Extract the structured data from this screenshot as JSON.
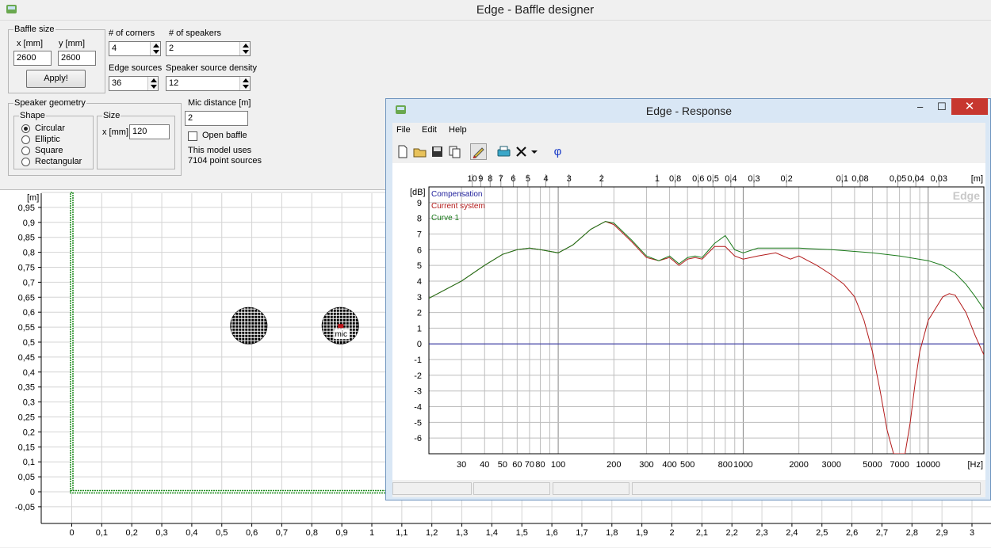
{
  "app": {
    "title": "Edge - Baffle designer"
  },
  "baffle_size": {
    "title": "Baffle size",
    "x_label": "x [mm]",
    "y_label": "y [mm]",
    "x_value": "2600",
    "y_value": "2600",
    "apply_label": "Apply!"
  },
  "corners": {
    "label": "# of corners",
    "value": "4"
  },
  "speakers": {
    "label": "# of speakers",
    "value": "2"
  },
  "edge_sources": {
    "label": "Edge sources",
    "value": "36"
  },
  "source_density": {
    "label": "Speaker source density",
    "value": "12"
  },
  "speaker_geometry": {
    "title": "Speaker geometry",
    "shape_title": "Shape",
    "shapes": [
      "Circular",
      "Elliptic",
      "Square",
      "Rectangular"
    ],
    "selected_shape": "Circular",
    "size_title": "Size",
    "size_x_label": "x [mm]",
    "size_x_value": "120"
  },
  "mic": {
    "label": "Mic distance [m]",
    "value": "2",
    "open_baffle_label": "Open baffle",
    "open_baffle_checked": false,
    "info_line1": "This model uses",
    "info_line2": "7104 point sources",
    "mic_label": "mic"
  },
  "baffle_plot": {
    "unit": "[m]",
    "y_ticks": [
      "0,95",
      "0,9",
      "0,85",
      "0,8",
      "0,75",
      "0,7",
      "0,65",
      "0,6",
      "0,55",
      "0,5",
      "0,45",
      "0,4",
      "0,35",
      "0,3",
      "0,25",
      "0,2",
      "0,15",
      "0,1",
      "0,05",
      "0",
      "-0,05"
    ],
    "x_ticks": [
      "0",
      "0,1",
      "0,2",
      "0,3",
      "0,4",
      "0,5",
      "0,6",
      "0,7",
      "0,8",
      "0,9",
      "1",
      "1,1",
      "1,2",
      "1,3",
      "1,4",
      "1,5",
      "1,6",
      "1,7",
      "1,8",
      "1,9",
      "2",
      "2,1",
      "2,2",
      "2,3",
      "2,4",
      "2,5",
      "2,6",
      "2,7",
      "2,8",
      "2,9",
      "3"
    ],
    "speakers_m": [
      {
        "x": 0.59,
        "y": 0.555
      },
      {
        "x": 0.895,
        "y": 0.555
      }
    ],
    "baffle_color": "#1a8a1a"
  },
  "response_window": {
    "title": "Edge - Response",
    "minimize": "–",
    "maximize": "☐",
    "close": "✕",
    "menu": [
      "File",
      "Edit",
      "Help"
    ],
    "toolbar_icons": [
      "new-file-icon",
      "open-folder-icon",
      "save-icon",
      "copy-icon",
      "pencil-icon",
      "printer-icon",
      "delete-icon",
      "dropdown-arrow-icon",
      "phase-icon"
    ],
    "phase_symbol": "φ",
    "watermark": "Edge"
  },
  "chart_data": {
    "type": "line",
    "ylabel": "[dB]",
    "xlabel": "[Hz]",
    "top_axis_unit": "[m]",
    "ylim": [
      -7,
      10
    ],
    "xlim_hz": [
      20,
      20000
    ],
    "x_scale": "log",
    "y_ticks": [
      9,
      8,
      7,
      6,
      5,
      4,
      3,
      2,
      1,
      0,
      -1,
      -2,
      -3,
      -4,
      -5,
      -6
    ],
    "x_tick_labels": [
      {
        "hz": 30,
        "label": "30"
      },
      {
        "hz": 40,
        "label": "40"
      },
      {
        "hz": 50,
        "label": "50"
      },
      {
        "hz": 60,
        "label": "60"
      },
      {
        "hz": 70,
        "label": "70"
      },
      {
        "hz": 80,
        "label": "80"
      },
      {
        "hz": 100,
        "label": "100"
      },
      {
        "hz": 200,
        "label": "200"
      },
      {
        "hz": 300,
        "label": "300"
      },
      {
        "hz": 400,
        "label": "400"
      },
      {
        "hz": 500,
        "label": "500"
      },
      {
        "hz": 800,
        "label": "800"
      },
      {
        "hz": 1000,
        "label": "1000"
      },
      {
        "hz": 2000,
        "label": "2000"
      },
      {
        "hz": 3000,
        "label": "3000"
      },
      {
        "hz": 5000,
        "label": "5000"
      },
      {
        "hz": 7000,
        "label": "7000"
      },
      {
        "hz": 10000,
        "label": "10000"
      }
    ],
    "top_tick_labels": [
      {
        "m": 10,
        "label": "10"
      },
      {
        "m": 9,
        "label": "9"
      },
      {
        "m": 8,
        "label": "8"
      },
      {
        "m": 7,
        "label": "7"
      },
      {
        "m": 6,
        "label": "6"
      },
      {
        "m": 5,
        "label": "5"
      },
      {
        "m": 4,
        "label": "4"
      },
      {
        "m": 3,
        "label": "3"
      },
      {
        "m": 2,
        "label": "2"
      },
      {
        "m": 1,
        "label": "1"
      },
      {
        "m": 0.8,
        "label": "0,8"
      },
      {
        "m": 0.6,
        "label": "0,6"
      },
      {
        "m": 0.5,
        "label": "0,5"
      },
      {
        "m": 0.4,
        "label": "0,4"
      },
      {
        "m": 0.3,
        "label": "0,3"
      },
      {
        "m": 0.2,
        "label": "0,2"
      },
      {
        "m": 0.1,
        "label": "0,1"
      },
      {
        "m": 0.08,
        "label": "0,08"
      },
      {
        "m": 0.05,
        "label": "0,05"
      },
      {
        "m": 0.04,
        "label": "0,04"
      },
      {
        "m": 0.03,
        "label": "0,03"
      }
    ],
    "grid": true,
    "legend_placement": "top-left",
    "series": [
      {
        "name": "Compensation",
        "color": "#1c1c9a",
        "points": [
          [
            20,
            0
          ],
          [
            20000,
            0
          ]
        ]
      },
      {
        "name": "Current system",
        "color": "#b31a1a",
        "points": [
          [
            20,
            2.9
          ],
          [
            30,
            4.0
          ],
          [
            40,
            5.0
          ],
          [
            50,
            5.7
          ],
          [
            60,
            6.0
          ],
          [
            70,
            6.1
          ],
          [
            80,
            6.0
          ],
          [
            100,
            5.8
          ],
          [
            120,
            6.3
          ],
          [
            150,
            7.3
          ],
          [
            180,
            7.8
          ],
          [
            200,
            7.6
          ],
          [
            250,
            6.5
          ],
          [
            300,
            5.5
          ],
          [
            350,
            5.3
          ],
          [
            400,
            5.5
          ],
          [
            450,
            5.0
          ],
          [
            500,
            5.4
          ],
          [
            550,
            5.5
          ],
          [
            600,
            5.4
          ],
          [
            700,
            6.2
          ],
          [
            800,
            6.2
          ],
          [
            900,
            5.6
          ],
          [
            1000,
            5.4
          ],
          [
            1200,
            5.6
          ],
          [
            1500,
            5.8
          ],
          [
            1800,
            5.4
          ],
          [
            2000,
            5.6
          ],
          [
            2500,
            5.0
          ],
          [
            3000,
            4.4
          ],
          [
            3500,
            3.8
          ],
          [
            4000,
            3.0
          ],
          [
            4500,
            1.5
          ],
          [
            5000,
            -0.5
          ],
          [
            5500,
            -3.0
          ],
          [
            6000,
            -5.5
          ],
          [
            6500,
            -7.0
          ],
          [
            7500,
            -7.0
          ],
          [
            8000,
            -5.0
          ],
          [
            8500,
            -2.5
          ],
          [
            9000,
            -0.5
          ],
          [
            10000,
            1.5
          ],
          [
            12000,
            3.0
          ],
          [
            13000,
            3.2
          ],
          [
            14000,
            3.1
          ],
          [
            16000,
            2.0
          ],
          [
            18000,
            0.5
          ],
          [
            20000,
            -0.7
          ]
        ]
      },
      {
        "name": "Curve 1",
        "color": "#1a7a1a",
        "points": [
          [
            20,
            2.9
          ],
          [
            30,
            4.0
          ],
          [
            40,
            5.0
          ],
          [
            50,
            5.7
          ],
          [
            60,
            6.0
          ],
          [
            70,
            6.1
          ],
          [
            80,
            6.0
          ],
          [
            100,
            5.8
          ],
          [
            120,
            6.3
          ],
          [
            150,
            7.3
          ],
          [
            180,
            7.8
          ],
          [
            200,
            7.7
          ],
          [
            250,
            6.6
          ],
          [
            300,
            5.6
          ],
          [
            350,
            5.3
          ],
          [
            400,
            5.6
          ],
          [
            450,
            5.1
          ],
          [
            500,
            5.5
          ],
          [
            550,
            5.6
          ],
          [
            600,
            5.5
          ],
          [
            700,
            6.4
          ],
          [
            800,
            6.9
          ],
          [
            900,
            6.0
          ],
          [
            1000,
            5.8
          ],
          [
            1200,
            6.1
          ],
          [
            1500,
            6.1
          ],
          [
            2000,
            6.1
          ],
          [
            3000,
            6.0
          ],
          [
            5000,
            5.8
          ],
          [
            7000,
            5.6
          ],
          [
            10000,
            5.3
          ],
          [
            12000,
            5.0
          ],
          [
            14000,
            4.5
          ],
          [
            16000,
            3.8
          ],
          [
            18000,
            3.0
          ],
          [
            20000,
            2.2
          ]
        ]
      }
    ]
  }
}
